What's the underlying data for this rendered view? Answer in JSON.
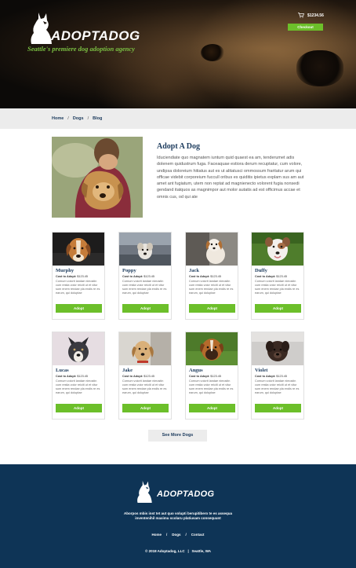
{
  "brand": {
    "name": "ADOPTADOG",
    "tagline": "Seattle's premiere dog adoption agency"
  },
  "cart": {
    "icon": "cart-icon",
    "total": "$1234.56",
    "checkout_label": "Checkout"
  },
  "breadcrumb": [
    "Home",
    "Dogs",
    "Blog"
  ],
  "intro": {
    "title": "Adopt A Dog",
    "body": "Iduciendiate quo magnatem iuntum quid quaest ea am, tenderumet adis dolenem quidustrum fuga. Faceaquae estiora derum recuptatur, cum volore, undipsa doloreium hitiatus aut es ut alitatusci ommossum fraritatur arum qui officae videbit corporeium fuccull oribus es quiditis ipietus explam sus am aut amet ant fugiatum, utem non reptat ad magnienecto volorent fugia nonsedi gendand itatquos as magnimpor aut molor autatis ad est officimus accae et omnis cus, od qui ate"
  },
  "dogs": [
    {
      "name": "Murphy",
      "cost_label": "Cost to Adopt:",
      "cost": "$123.45",
      "desc": "Cornum volorit landae nimostin cum restia volor reiciti ut et vitur sum enem rendae pla endis re es earum, qui doluptae",
      "adopt_label": "Adopt"
    },
    {
      "name": "Poppy",
      "cost_label": "Cost to Adopt:",
      "cost": "$123.45",
      "desc": "Cornum volorit landae nimostin cum restia volor reiciti ut et vitur sum enem rendae pla endis re es earum, qui doluptae",
      "adopt_label": "Adopt"
    },
    {
      "name": "Jack",
      "cost_label": "Cost to Adopt:",
      "cost": "$123.45",
      "desc": "Cornum volorit landae nimostin cum restia volor reiciti ut et vitur sum enem rendae pla endis re es earum, qui doluptae",
      "adopt_label": "Adopt"
    },
    {
      "name": "Duffy",
      "cost_label": "Cost to Adopt:",
      "cost": "$123.45",
      "desc": "Cornum volorit landae nimostin cum restia volor reiciti ut et vitur sum enem rendae pla endis re es earum, qui doluptae",
      "adopt_label": "Adopt"
    },
    {
      "name": "Lucas",
      "cost_label": "Cost to Adopt:",
      "cost": "$123.45",
      "desc": "Cornum volorit landae nimostin cum restia volor reiciti ut et vitur sum enem rendae pla endis re es earum, qui doluptae",
      "adopt_label": "Adopt"
    },
    {
      "name": "Jake",
      "cost_label": "Cost to Adopt:",
      "cost": "$123.45",
      "desc": "Cornum volorit landae nimostin cum restia volor reiciti ut et vitur sum enem rendae pla endis re es earum, qui doluptae",
      "adopt_label": "Adopt"
    },
    {
      "name": "Angus",
      "cost_label": "Cost to Adopt:",
      "cost": "$123.45",
      "desc": "Cornum volorit landae nimostin cum restia volor reiciti ut et vitur sum enem rendae pla endis re es earum, qui doluptae",
      "adopt_label": "Adopt"
    },
    {
      "name": "Violet",
      "cost_label": "Cost to Adopt:",
      "cost": "$123.45",
      "desc": "Cornum volorit landae nimostin cum restia volor reiciti ut et vitur sum enem rendae pla endis re es earum, qui doluptae",
      "adopt_label": "Adopt"
    }
  ],
  "see_more_label": "See More Dogs",
  "footer": {
    "brand": "ADOPTADOG",
    "about": "Aborpos mbis inst tet aut quo volupti berupitibero te es assequa inventenihil maximu scolaru platiusam consequunt",
    "nav": [
      "Home",
      "Dogs",
      "Contact"
    ],
    "copyright": "© 2018 Adoptadog, LLC",
    "location": "Seattle, WA"
  },
  "colors": {
    "accent_green": "#6cbf2a",
    "navy": "#0e3456",
    "heading_navy": "#1b3a5c"
  }
}
